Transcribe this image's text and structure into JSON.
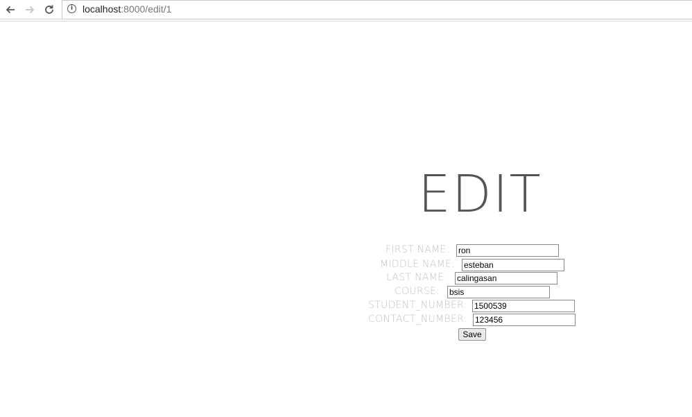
{
  "browser": {
    "url_host": "localhost",
    "url_path": ":8000/edit/1"
  },
  "page": {
    "title": "EDIT"
  },
  "form": {
    "fields": [
      {
        "label": "FIRST NAME:",
        "value": "ron"
      },
      {
        "label": "MIDDLE NAME:",
        "value": "esteban"
      },
      {
        "label": "LAST NAME:",
        "value": "calingasan"
      },
      {
        "label": "COURSE:",
        "value": "bsis"
      },
      {
        "label": "STUDENT_NUMBER:",
        "value": "1500539"
      },
      {
        "label": "CONTACT_NUMBER:",
        "value": "123456"
      }
    ],
    "save_label": "Save"
  }
}
